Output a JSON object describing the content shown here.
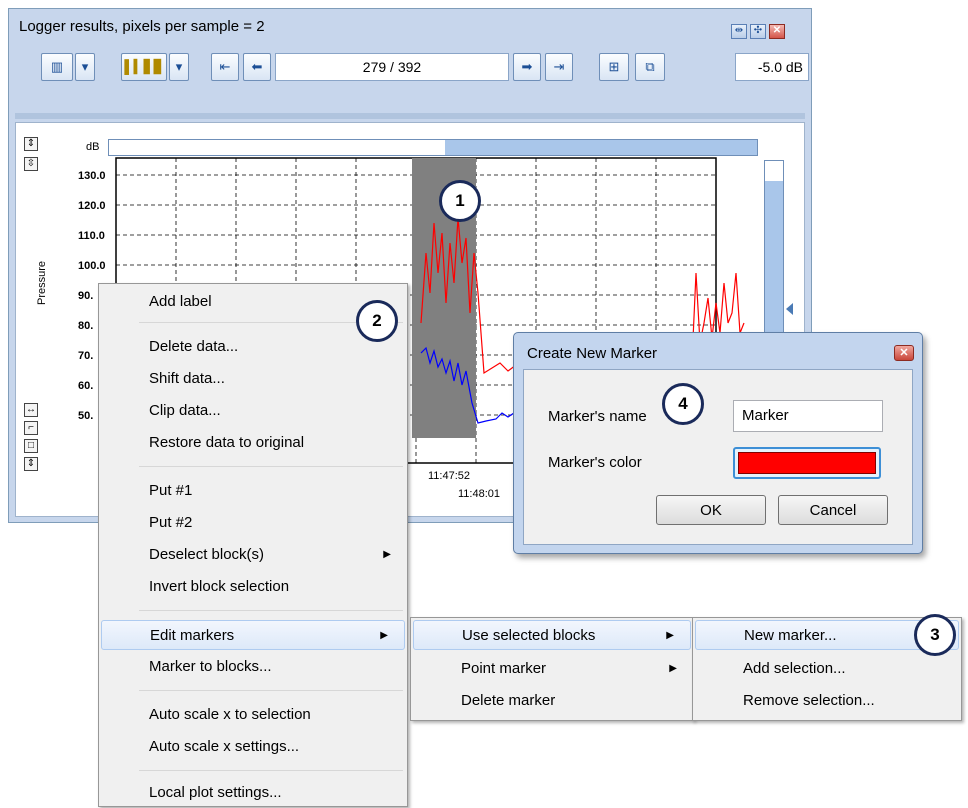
{
  "window": {
    "title": "Logger results, pixels per sample = 2",
    "title_icons": [
      "resize-icon",
      "fit-icon",
      "close-icon"
    ]
  },
  "toolbar": {
    "position": "279 / 392",
    "level": "-5.0 dB"
  },
  "plot": {
    "unit": "dB",
    "axis_label": "Pressure",
    "y_ticks": [
      "130.0",
      "120.0",
      "110.0",
      "100.0",
      "90.",
      "80.",
      "70.",
      "60.",
      "50."
    ],
    "x_ticks": [
      "11:47:52",
      "11:48:01"
    ]
  },
  "context_menu": {
    "items": [
      {
        "label": "Add label"
      },
      {
        "label": "Delete data..."
      },
      {
        "label": "Shift data..."
      },
      {
        "label": "Clip data..."
      },
      {
        "label": "Restore data to original"
      },
      {
        "label": "Put #1"
      },
      {
        "label": "Put #2"
      },
      {
        "label": "Deselect block(s)"
      },
      {
        "label": "Invert block selection"
      },
      {
        "label": "Edit markers"
      },
      {
        "label": "Marker to blocks..."
      },
      {
        "label": "Auto scale x to selection"
      },
      {
        "label": "Auto scale x settings..."
      },
      {
        "label": "Local plot settings..."
      }
    ]
  },
  "submenu_markers": {
    "items": [
      {
        "label": "Use selected blocks"
      },
      {
        "label": "Point marker"
      },
      {
        "label": "Delete marker"
      }
    ]
  },
  "submenu_selected": {
    "items": [
      {
        "label": "New marker..."
      },
      {
        "label": "Add selection..."
      },
      {
        "label": "Remove selection..."
      }
    ]
  },
  "dialog": {
    "title": "Create New Marker",
    "name_label": "Marker's name",
    "name_value": "Marker",
    "color_label": "Marker's color",
    "color_value": "#ff0000",
    "ok": "OK",
    "cancel": "Cancel"
  },
  "callouts": [
    "1",
    "2",
    "3",
    "4"
  ],
  "colors": {
    "accent": "#1a2a5a",
    "trace_red": "#ff0000",
    "trace_blue": "#0000ff"
  }
}
